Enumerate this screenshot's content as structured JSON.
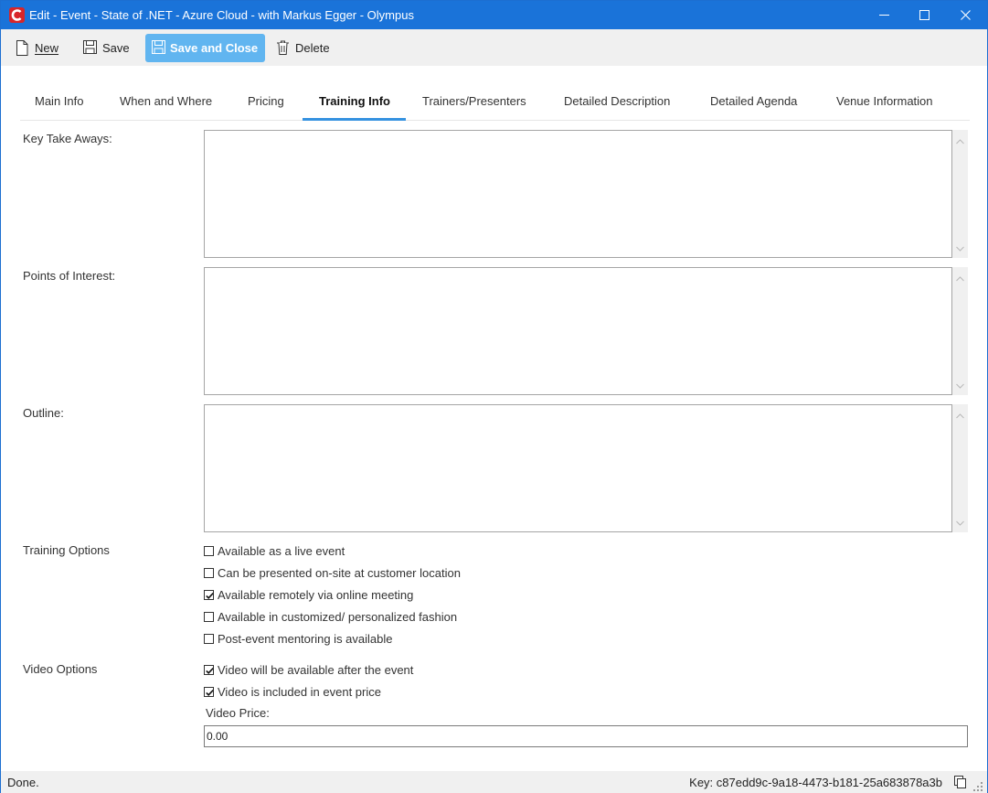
{
  "window": {
    "title": "Edit - Event - State of .NET - Azure Cloud - with Markus Egger - Olympus"
  },
  "toolbar": {
    "new_label": "New",
    "save_label": "Save",
    "save_close_label": "Save and Close",
    "delete_label": "Delete"
  },
  "tabs": [
    {
      "label": "Main Info"
    },
    {
      "label": "When and Where"
    },
    {
      "label": "Pricing"
    },
    {
      "label": "Training Info",
      "active": true
    },
    {
      "label": "Trainers/Presenters"
    },
    {
      "label": "Detailed Description"
    },
    {
      "label": "Detailed Agenda"
    },
    {
      "label": "Venue Information"
    }
  ],
  "form": {
    "key_take_aways": {
      "label": "Key Take Aways:",
      "value": ""
    },
    "points_of_interest": {
      "label": "Points of Interest:",
      "value": ""
    },
    "outline": {
      "label": "Outline:",
      "value": ""
    },
    "training_options": {
      "label": "Training Options",
      "options": [
        {
          "label": "Available as a live event",
          "checked": false
        },
        {
          "label": "Can be presented on-site at customer location",
          "checked": false
        },
        {
          "label": "Available remotely via online meeting",
          "checked": true
        },
        {
          "label": "Available in customized/ personalized fashion",
          "checked": false
        },
        {
          "label": "Post-event mentoring is available",
          "checked": false
        }
      ]
    },
    "video_options": {
      "label": "Video Options",
      "options": [
        {
          "label": "Video will be available after the event",
          "checked": true
        },
        {
          "label": "Video is included in event price",
          "checked": true
        }
      ],
      "price_label": "Video Price:",
      "price_value": "0.00"
    }
  },
  "status": {
    "text": "Done.",
    "key": "Key: c87edd9c-9a18-4473-b181-25a683878a3b"
  },
  "colors": {
    "titlebar": "#1a73d9",
    "primary_button": "#61b5f0",
    "active_tab_underline": "#3592e0",
    "app_icon": "#d8262a"
  }
}
